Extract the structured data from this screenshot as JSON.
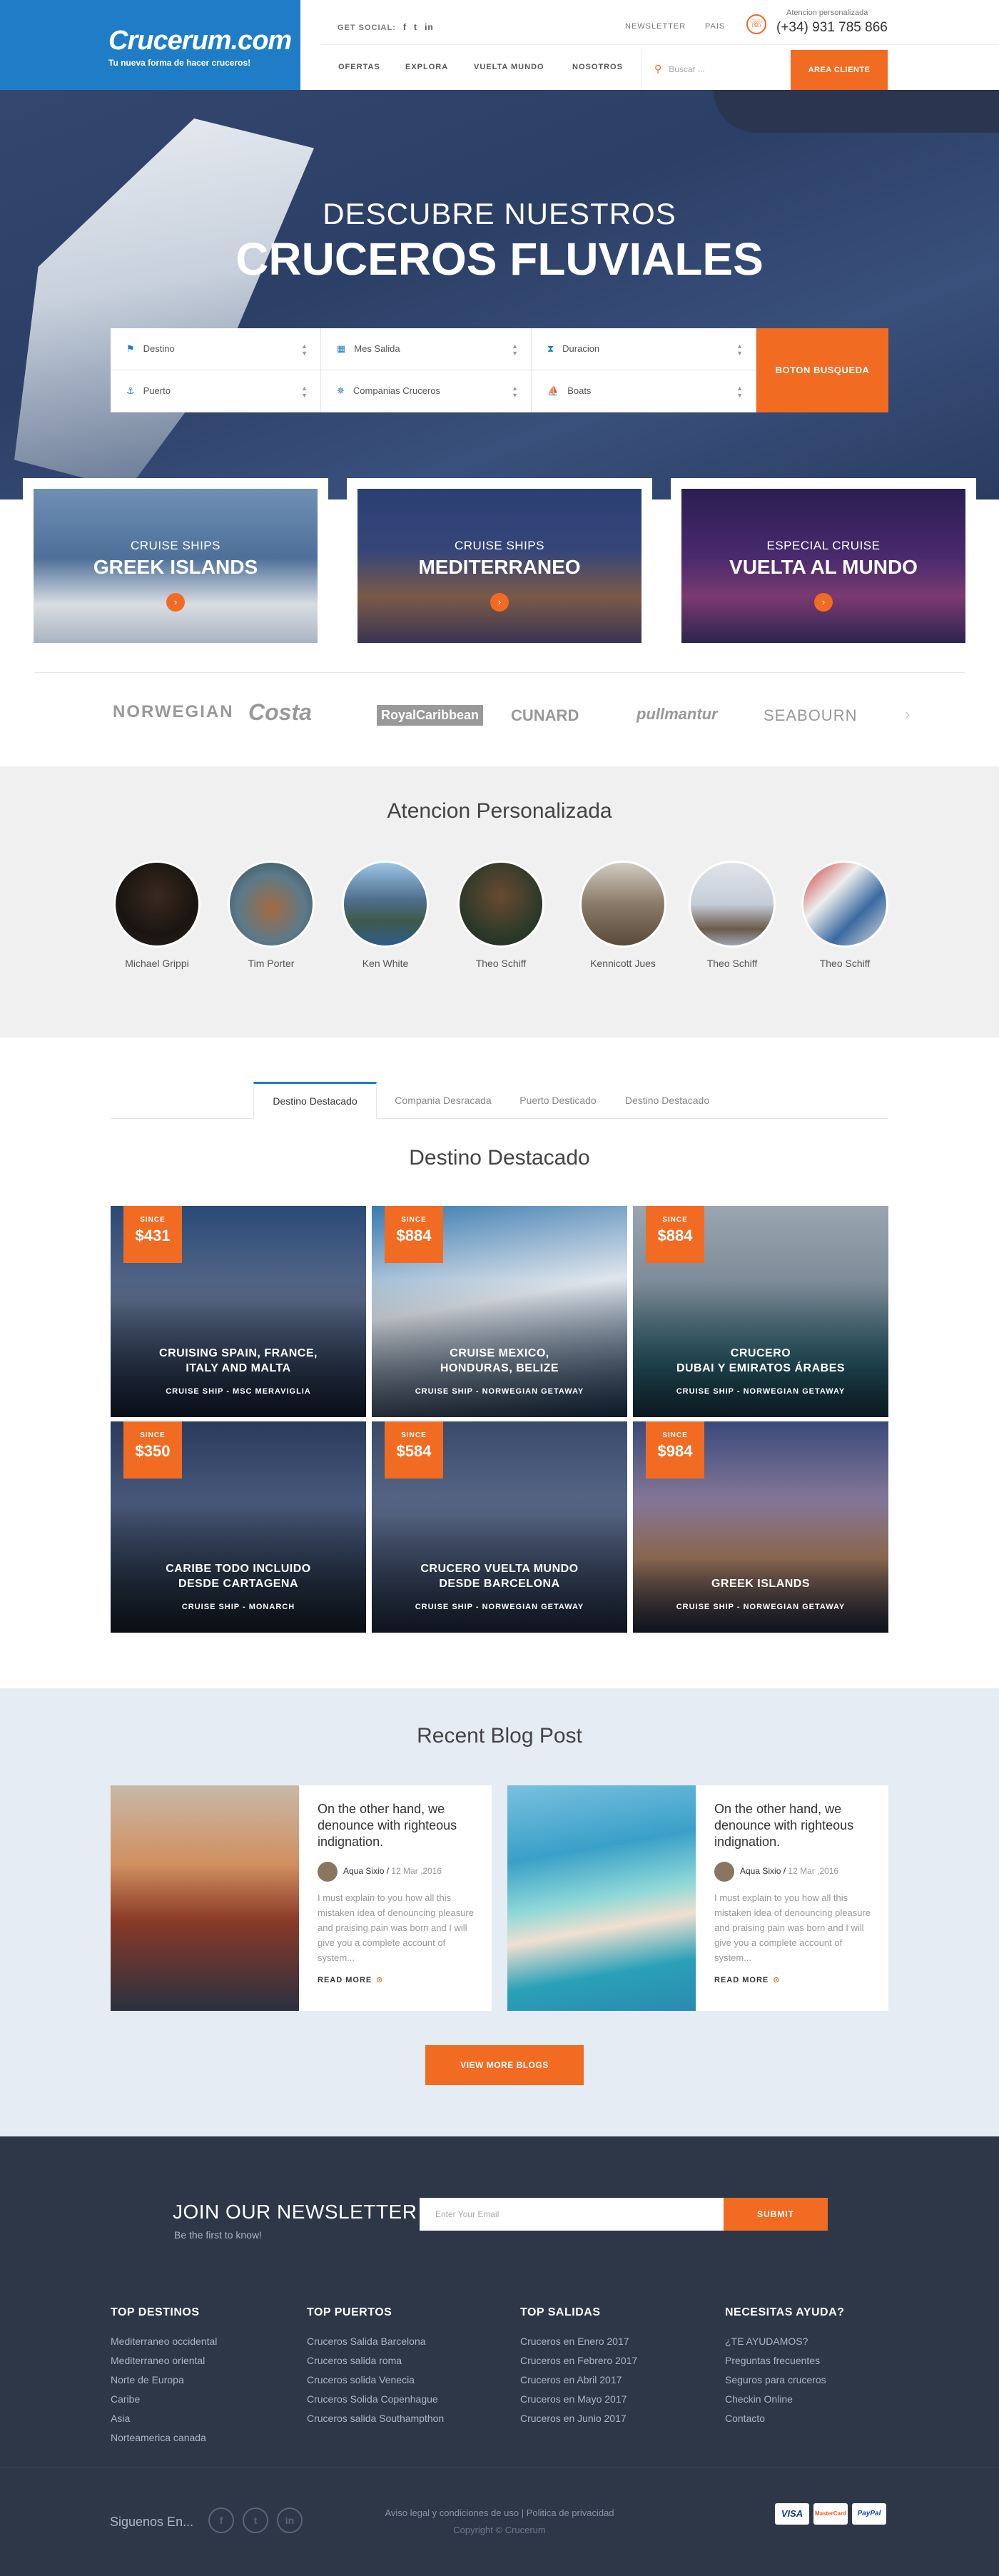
{
  "header": {
    "logo_name": "Crucerum.com",
    "logo_tagline": "Tu nueva forma de hacer cruceros!",
    "social_label": "GET SOCIAL:",
    "social_icons": [
      "facebook-icon",
      "twitter-icon",
      "linkedin-icon"
    ],
    "newsletter": "NEWSLETTER",
    "pais": "PAIS",
    "phone_label": "Atencion personalizada",
    "phone_number": "(+34) 931 785 866",
    "nav": [
      "OFERTAS",
      "EXPLORA",
      "VUELTA MUNDO",
      "NOSOTROS"
    ],
    "search_placeholder": "Buscar ...",
    "area_button": "AREA CLIENTE"
  },
  "hero": {
    "line1": "DESCUBRE NUESTROS",
    "line2": "CRUCEROS FLUVIALES",
    "fields": [
      "Destino",
      "Mes Salida",
      "Duracion",
      "Puerto",
      "Companias Cruceros",
      "Boats"
    ],
    "button": "BOTON BUSQUEDA"
  },
  "features": [
    {
      "line1": "CRUISE SHIPS",
      "line2": "GREEK ISLANDS"
    },
    {
      "line1": "CRUISE SHIPS",
      "line2": "MEDITERRANEO"
    },
    {
      "line1": "ESPECIAL CRUISE",
      "line2": "VUELTA AL MUNDO"
    }
  ],
  "brands": [
    "NORWEGIAN",
    "Costa",
    "RoyalCaribbean",
    "CUNARD",
    "pullmantur",
    "SEABOURN"
  ],
  "attention": {
    "title": "Atencion Personalizada",
    "agents": [
      "Michael Grippi",
      "Tim Porter",
      "Ken White",
      "Theo Schiff",
      "Kennicott Jues",
      "Theo Schiff",
      "Theo Schiff"
    ]
  },
  "tabs": [
    "Destino Destacado",
    "Compania Desracada",
    "Puerto Desticado",
    "Destino Destacado"
  ],
  "destinations": {
    "title": "Destino Destacado",
    "since_label": "SINCE",
    "cards": [
      {
        "price": "$431",
        "title1": "CRUISING SPAIN, FRANCE,",
        "title2": "ITALY AND MALTA",
        "sub": "CRUISE SHIP -  MSC MERAVIGLIA"
      },
      {
        "price": "$884",
        "title1": "CRUISE MEXICO,",
        "title2": "HONDURAS, BELIZE",
        "sub": "CRUISE SHIP -  NORWEGIAN GETAWAY"
      },
      {
        "price": "$884",
        "title1": "CRUCERO",
        "title2": "DUBAI Y EMIRATOS ÁRABES",
        "sub": "CRUISE SHIP -  NORWEGIAN GETAWAY"
      },
      {
        "price": "$350",
        "title1": "CARIBE TODO INCLUIDO",
        "title2": "DESDE CARTAGENA",
        "sub": "CRUISE SHIP -  MONARCH"
      },
      {
        "price": "$584",
        "title1": "CRUCERO VUELTA MUNDO",
        "title2": "DESDE BARCELONA",
        "sub": "CRUISE SHIP -  NORWEGIAN GETAWAY"
      },
      {
        "price": "$984",
        "title1": "",
        "title2": "GREEK ISLANDS",
        "sub": "CRUISE SHIP -  NORWEGIAN GETAWAY"
      }
    ]
  },
  "blog": {
    "title": "Recent Blog Post",
    "posts": [
      {
        "title": "On the other hand, we denounce with righteous indignation.",
        "author": "Aqua Sixio /",
        "date": "12 Mar ,2016",
        "excerpt": "I must explain to you how all this mistaken idea of denouncing pleasure and praising pain was born and I will give you a complete account of  system...",
        "read_more": "READ MORE"
      },
      {
        "title": "On the other hand, we denounce with righteous indignation.",
        "author": "Aqua Sixio /",
        "date": "12 Mar ,2016",
        "excerpt": "I must explain to you how all this mistaken idea of denouncing pleasure and praising pain was born and I will give you a complete account of  system...",
        "read_more": "READ MORE"
      }
    ],
    "view_more": "VIEW MORE BLOGS"
  },
  "footer": {
    "newsletter_title": "JOIN OUR NEWSLETTER",
    "newsletter_sub": "Be the first to know!",
    "email_placeholder": "Enter Your Email",
    "submit": "SUBMIT",
    "columns": [
      {
        "heading": "TOP DESTINOS",
        "items": [
          "Mediterraneo occidental",
          "Mediterraneo oriental",
          "Norte de Europa",
          "Caribe",
          "Asia",
          "Norteamerica canada"
        ]
      },
      {
        "heading": "TOP PUERTOS",
        "items": [
          "Cruceros Salida Barcelona",
          "Cruceros salida roma",
          "Cruceros solida Venecia",
          "Cruceros Solida Copenhague",
          "Cruceros salida Southampthon"
        ]
      },
      {
        "heading": "TOP SALIDAS",
        "items": [
          "Cruceros en Enero 2017",
          "Cruceros en Febrero 2017",
          "Cruceros en Abril 2017",
          "Cruceros en Mayo 2017",
          "Cruceros en Junio 2017"
        ]
      },
      {
        "heading": "NECESITAS AYUDA?",
        "items": [
          "¿TE AYUDAMOS?",
          "Preguntas frecuentes",
          "Seguros para cruceros",
          "Checkin Online",
          "Contacto"
        ]
      }
    ],
    "follow": "Siguenos En...",
    "legal": "Aviso legal y condiciones de uso | Politica de privacidad",
    "copyright": "Copyright © Crucerum",
    "payments": [
      "VISA",
      "MasterCard",
      "PayPal"
    ]
  },
  "colors": {
    "brand_blue": "#1f7dc7",
    "accent_orange": "#f26b22",
    "footer_bg": "#2d3747"
  }
}
